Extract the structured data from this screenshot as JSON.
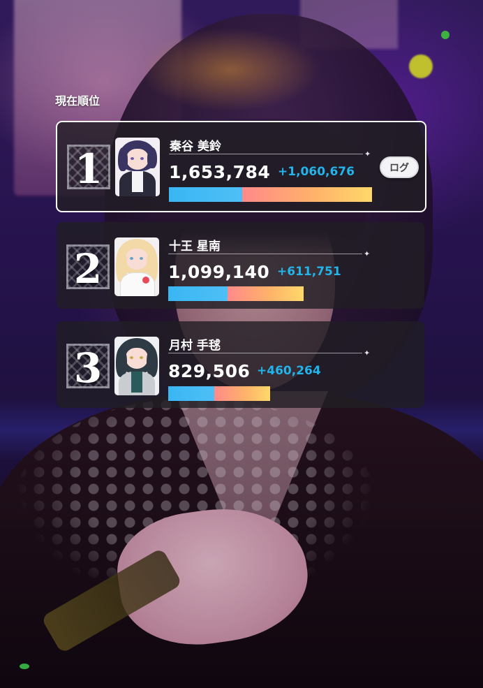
{
  "section_title": "現在順位",
  "rankings": [
    {
      "rank": "1",
      "name": "秦谷 美鈴",
      "score": "1,653,784",
      "delta": "+1,060,676",
      "bar": {
        "blue_fraction": 0.36,
        "warm_fraction": 0.64
      },
      "log_button": "ログ"
    },
    {
      "rank": "2",
      "name": "十王 星南",
      "score": "1,099,140",
      "delta": "+611,751",
      "bar": {
        "blue_fraction": 0.44,
        "warm_fraction": 0.56
      }
    },
    {
      "rank": "3",
      "name": "月村 手毬",
      "score": "829,506",
      "delta": "+460,264",
      "bar": {
        "blue_fraction": 0.45,
        "warm_fraction": 0.55
      }
    }
  ],
  "icons": {
    "rank_badge": "rank-badge-icon",
    "sparkle": "sparkle-icon"
  },
  "colors": {
    "delta_text": "#22b4ea",
    "bar_blue": "#3ab6f3",
    "bar_warm_start": "#ff8a8a",
    "bar_warm_end": "#ffd86a",
    "card_bg": "rgba(32,30,36,0.80)"
  }
}
